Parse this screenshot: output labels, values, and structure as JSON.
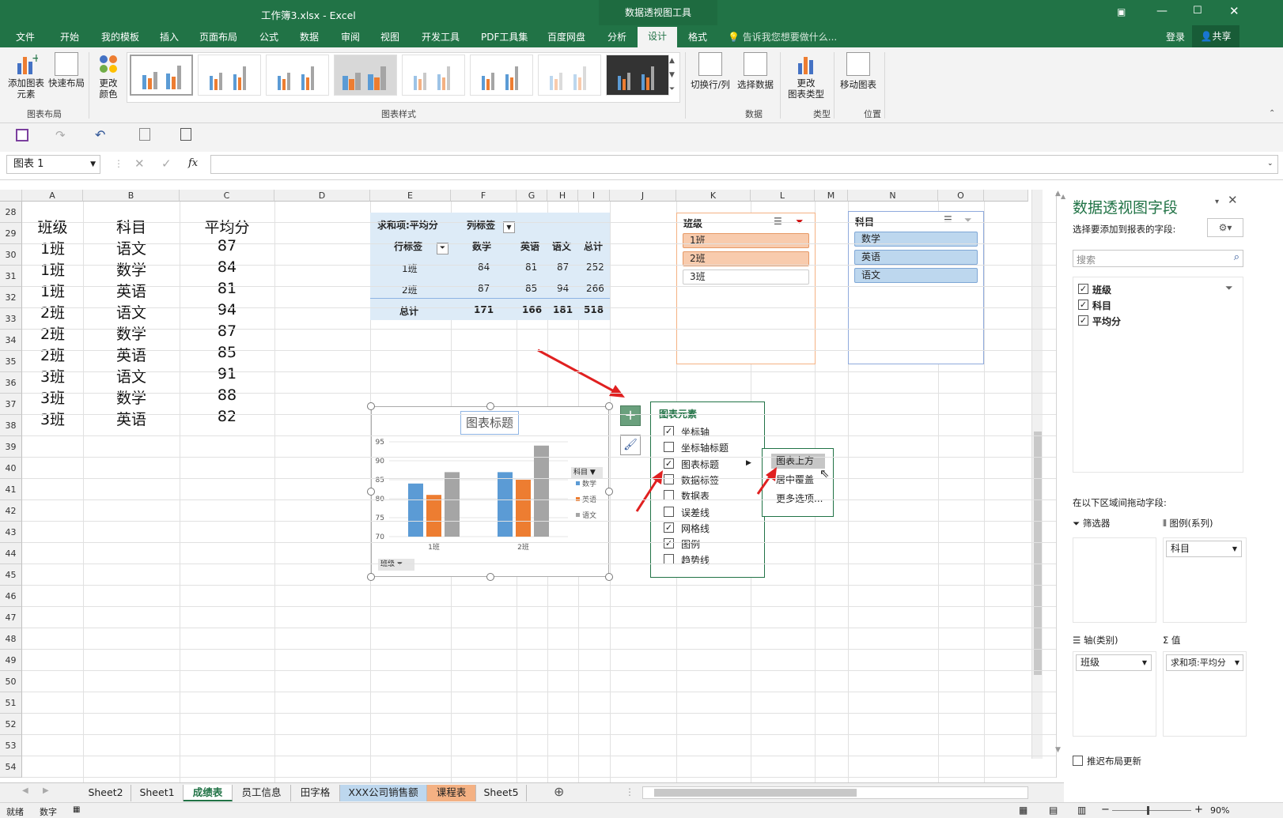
{
  "titlebar": {
    "title": "工作簿3.xlsx - Excel",
    "context_tab": "数据透视图工具"
  },
  "tabs": [
    "文件",
    "开始",
    "我的模板",
    "插入",
    "页面布局",
    "公式",
    "数据",
    "审阅",
    "视图",
    "开发工具",
    "PDF工具集",
    "百度网盘",
    "分析",
    "设计",
    "格式"
  ],
  "tell_me": "告诉我您想要做什么...",
  "account": {
    "login": "登录",
    "share": "共享"
  },
  "ribbon": {
    "add_element": "添加图表\n元素",
    "quick_layout": "快速布局",
    "change_color": "更改\n颜色",
    "group_layout": "图表布局",
    "group_styles": "图表样式",
    "switch_rowcol": "切换行/列",
    "select_data": "选择数据",
    "group_data": "数据",
    "change_type": "更改\n图表类型",
    "group_type": "类型",
    "move_chart": "移动图表",
    "group_location": "位置"
  },
  "formula_bar": {
    "name_box": "图表 1",
    "fx": "fx",
    "value": ""
  },
  "columns": [
    "A",
    "B",
    "C",
    "D",
    "E",
    "F",
    "G",
    "H",
    "I",
    "J",
    "K",
    "L",
    "M",
    "N",
    "O"
  ],
  "rows": [
    "28",
    "29",
    "30",
    "31",
    "32",
    "33",
    "34",
    "35",
    "36",
    "37",
    "38",
    "39",
    "40",
    "41",
    "42",
    "43",
    "44",
    "45",
    "46",
    "47",
    "48",
    "49",
    "50",
    "51",
    "52",
    "53",
    "54"
  ],
  "table": {
    "headers": [
      "班级",
      "科目",
      "平均分"
    ],
    "rows": [
      [
        "1班",
        "语文",
        "87"
      ],
      [
        "1班",
        "数学",
        "84"
      ],
      [
        "1班",
        "英语",
        "81"
      ],
      [
        "2班",
        "语文",
        "94"
      ],
      [
        "2班",
        "数学",
        "87"
      ],
      [
        "2班",
        "英语",
        "85"
      ],
      [
        "3班",
        "语文",
        "91"
      ],
      [
        "3班",
        "数学",
        "88"
      ],
      [
        "3班",
        "英语",
        "82"
      ]
    ]
  },
  "pivot": {
    "value_label": "求和项:平均分",
    "col_label": "列标签",
    "row_label": "行标签",
    "col_headers": [
      "数学",
      "英语",
      "语文",
      "总计"
    ],
    "rows": [
      {
        "label": "1班",
        "values": [
          "84",
          "81",
          "87",
          "252"
        ]
      },
      {
        "label": "2班",
        "values": [
          "87",
          "85",
          "94",
          "266"
        ]
      }
    ],
    "total": {
      "label": "总计",
      "values": [
        "171",
        "166",
        "181",
        "518"
      ]
    }
  },
  "slicer_class": {
    "title": "班级",
    "items": [
      "1班",
      "2班",
      "3班"
    ]
  },
  "slicer_subject": {
    "title": "科目",
    "items": [
      "数学",
      "英语",
      "语文"
    ]
  },
  "chart": {
    "title": "图表标题",
    "legend_title": "科目",
    "axis_field": "班级",
    "colors": [
      "#5b9bd5",
      "#ed7d31",
      "#a5a5a5"
    ]
  },
  "chart_data": {
    "type": "bar",
    "title": "图表标题",
    "categories": [
      "1班",
      "2班"
    ],
    "series": [
      {
        "name": "数学",
        "values": [
          84,
          87
        ]
      },
      {
        "name": "英语",
        "values": [
          81,
          85
        ]
      },
      {
        "name": "语文",
        "values": [
          87,
          94
        ]
      }
    ],
    "yticks": [
      "95",
      "90",
      "85",
      "80",
      "75",
      "70"
    ],
    "ylim": [
      70,
      95
    ],
    "legend_placement": "right",
    "grid": true
  },
  "chart_elements": {
    "title": "图表元素",
    "items": [
      {
        "label": "坐标轴",
        "checked": true
      },
      {
        "label": "坐标轴标题",
        "checked": false
      },
      {
        "label": "图表标题",
        "checked": true
      },
      {
        "label": "数据标签",
        "checked": false
      },
      {
        "label": "数据表",
        "checked": false
      },
      {
        "label": "误差线",
        "checked": false
      },
      {
        "label": "网格线",
        "checked": true
      },
      {
        "label": "图例",
        "checked": true
      },
      {
        "label": "趋势线",
        "checked": false
      }
    ]
  },
  "submenu": [
    "图表上方",
    "居中覆盖",
    "更多选项..."
  ],
  "pane": {
    "title": "数据透视图字段",
    "subtitle": "选择要添加到报表的字段:",
    "search_placeholder": "搜索",
    "fields": [
      "班级",
      "科目",
      "平均分"
    ],
    "drag_label": "在以下区域间拖动字段:",
    "filter": "筛选器",
    "legend": "图例(系列)",
    "legend_value": "科目",
    "axis": "轴(类别)",
    "axis_value": "班级",
    "values": "值",
    "values_value": "求和项:平均分",
    "defer": "推迟布局更新"
  },
  "sheets": [
    "Sheet2",
    "Sheet1",
    "成绩表",
    "员工信息",
    "田字格",
    "XXX公司销售额",
    "课程表",
    "Sheet5"
  ],
  "status": {
    "ready": "就绪",
    "num": "数字",
    "zoom": "90%"
  }
}
